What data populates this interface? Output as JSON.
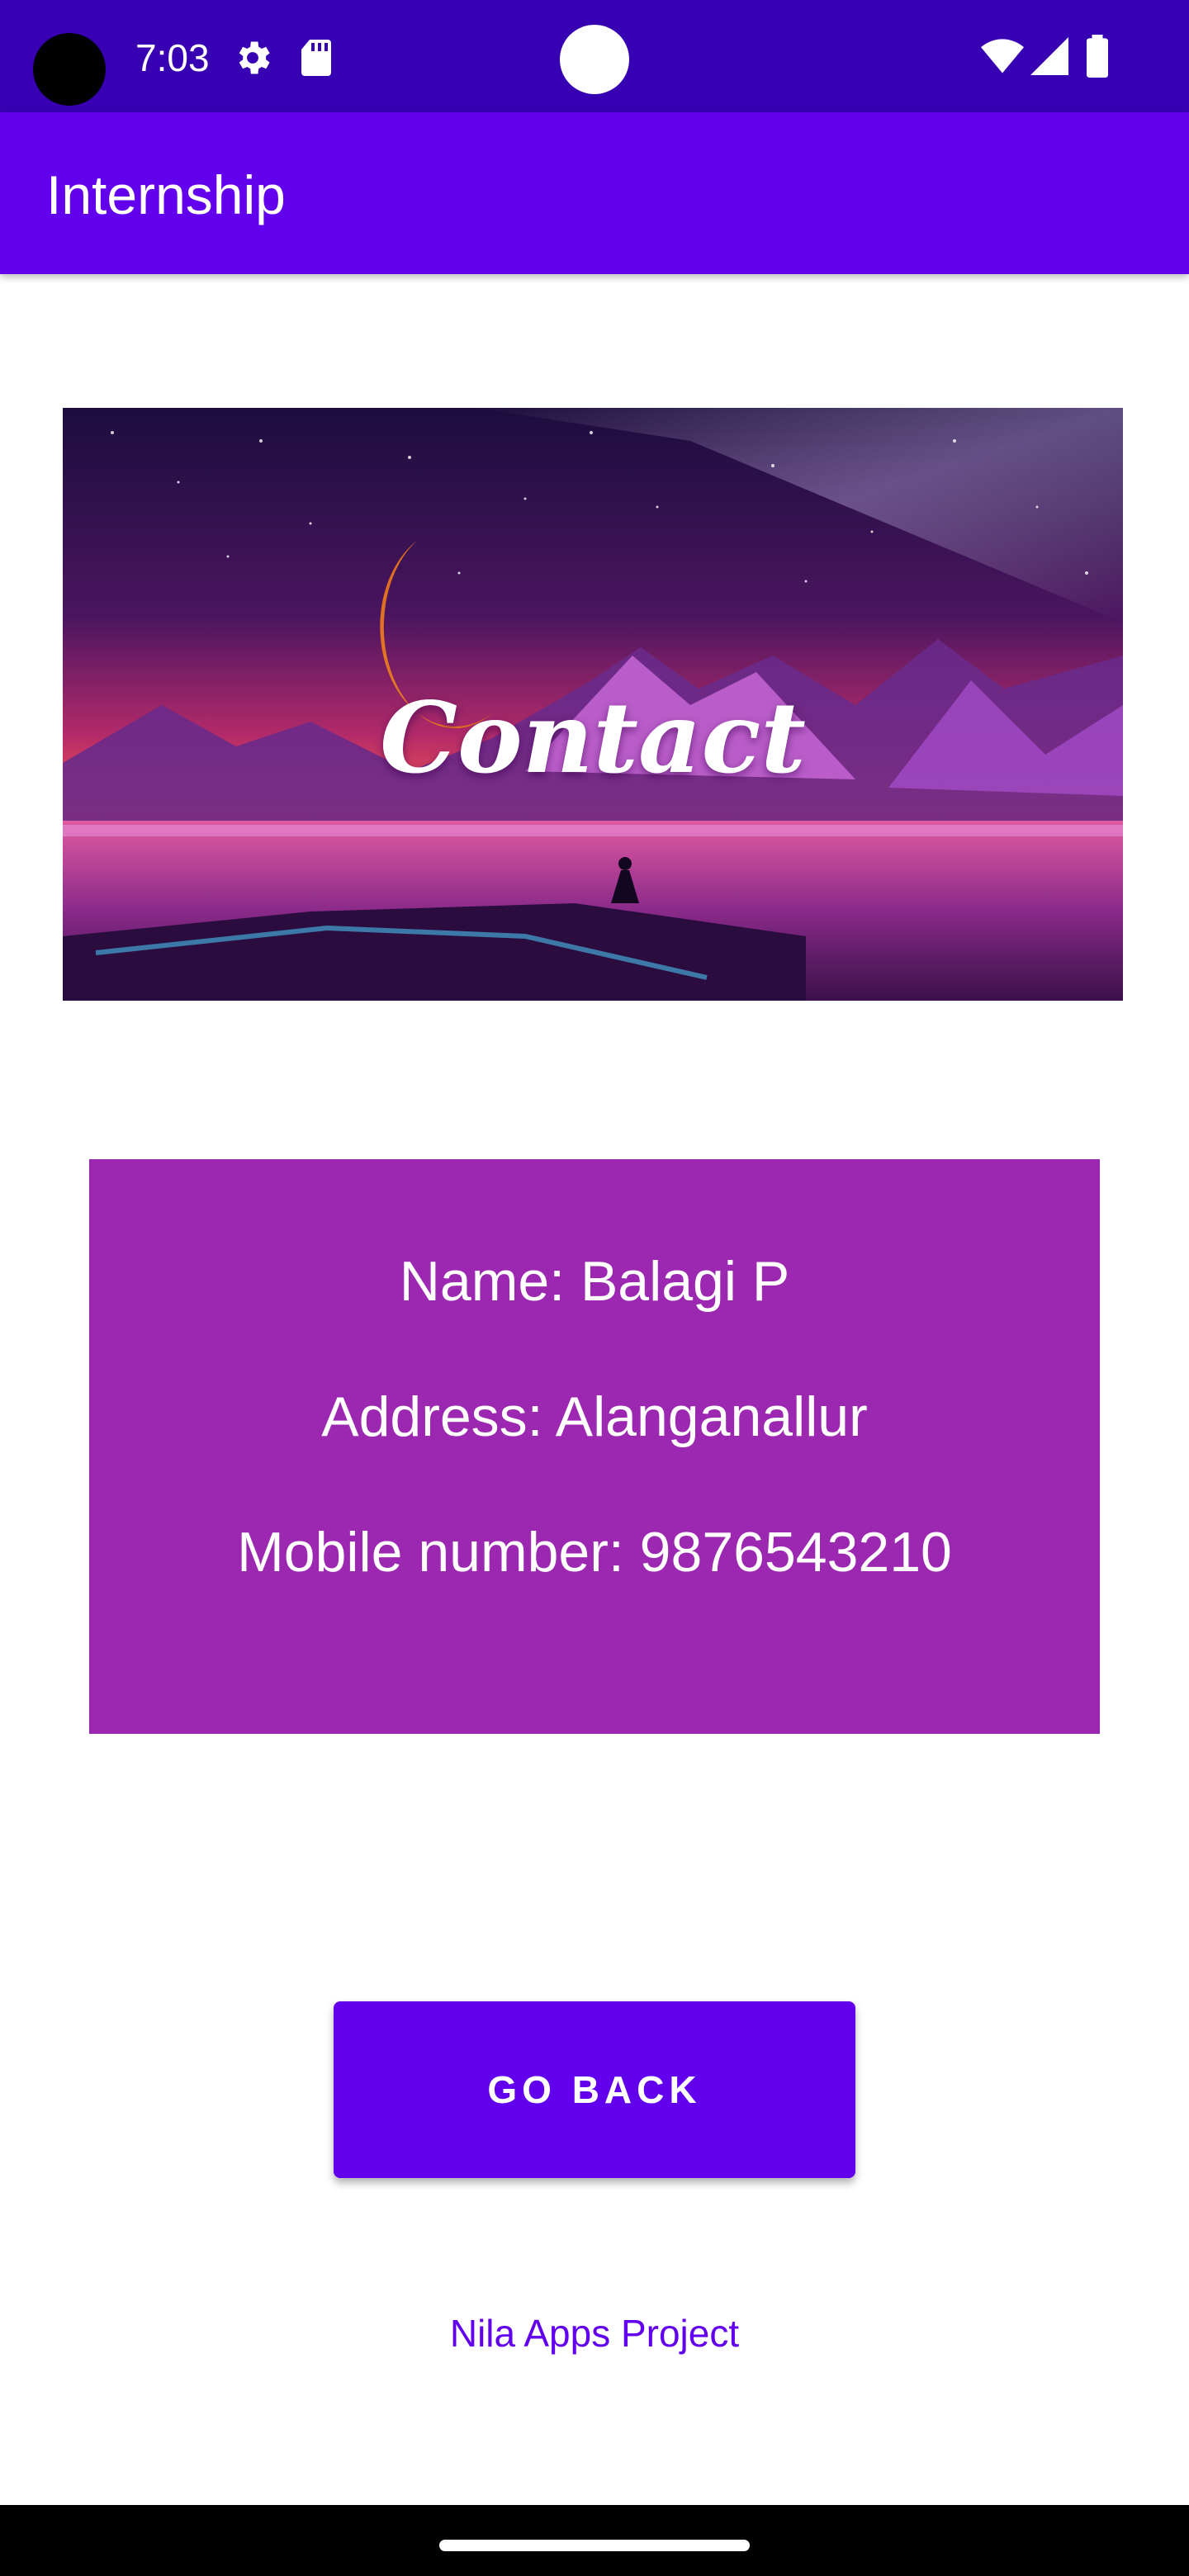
{
  "status_bar": {
    "time": "7:03",
    "icons": [
      "camera-cutout",
      "gear-icon",
      "sd-card-icon",
      "wifi-icon",
      "signal-icon",
      "battery-icon"
    ],
    "color": "#3700B3"
  },
  "app_bar": {
    "title": "Internship",
    "color": "#6200EE"
  },
  "banner": {
    "title": "Contact"
  },
  "contact": {
    "name": "Name: Balagi P",
    "address": "Address: Alanganallur",
    "mobile": "Mobile number: 9876543210",
    "card_color": "#9C27B0"
  },
  "actions": {
    "go_back_label": "GO BACK"
  },
  "footer": {
    "text": "Nila Apps Project"
  }
}
